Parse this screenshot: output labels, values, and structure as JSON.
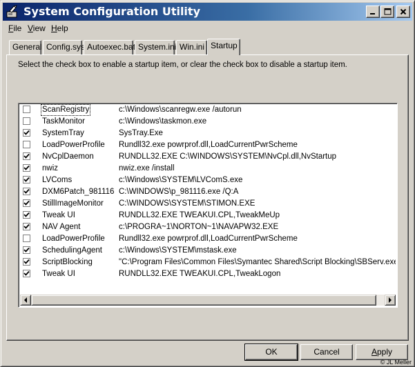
{
  "window": {
    "title": "System Configuration Utility"
  },
  "menu": [
    {
      "prefix": "",
      "accel": "F",
      "rest": "ile"
    },
    {
      "prefix": "",
      "accel": "V",
      "rest": "iew"
    },
    {
      "prefix": "",
      "accel": "H",
      "rest": "elp"
    }
  ],
  "tabs": [
    {
      "label": "General"
    },
    {
      "label": "Config.sys"
    },
    {
      "label": "Autoexec.bat"
    },
    {
      "label": "System.ini"
    },
    {
      "label": "Win.ini"
    },
    {
      "label": "Startup"
    }
  ],
  "active_tab": "Startup",
  "startup": {
    "instructions": "Select the check box to enable a startup item, or clear the check box to disable a startup item.",
    "items": [
      {
        "checked": false,
        "name": "ScanRegistry",
        "command": "c:\\Windows\\scanregw.exe /autorun"
      },
      {
        "checked": false,
        "name": "TaskMonitor",
        "command": "c:\\Windows\\taskmon.exe"
      },
      {
        "checked": true,
        "name": "SystemTray",
        "command": "SysTray.Exe"
      },
      {
        "checked": false,
        "name": "LoadPowerProfile",
        "command": "Rundll32.exe powrprof.dll,LoadCurrentPwrScheme"
      },
      {
        "checked": true,
        "name": "NvCplDaemon",
        "command": "RUNDLL32.EXE C:\\WINDOWS\\SYSTEM\\NvCpl.dll,NvStartup"
      },
      {
        "checked": true,
        "name": "nwiz",
        "command": "nwiz.exe /install"
      },
      {
        "checked": true,
        "name": "LVComs",
        "command": "c:\\Windows\\SYSTEM\\LVComS.exe"
      },
      {
        "checked": true,
        "name": "DXM6Patch_981116",
        "command": "C:\\WINDOWS\\p_981116.exe /Q:A"
      },
      {
        "checked": true,
        "name": "StillImageMonitor",
        "command": "C:\\WINDOWS\\SYSTEM\\STIMON.EXE"
      },
      {
        "checked": true,
        "name": "Tweak UI",
        "command": "RUNDLL32.EXE TWEAKUI.CPL,TweakMeUp"
      },
      {
        "checked": true,
        "name": "NAV Agent",
        "command": "c:\\PROGRA~1\\NORTON~1\\NAVAPW32.EXE"
      },
      {
        "checked": false,
        "name": "LoadPowerProfile",
        "command": "Rundll32.exe powrprof.dll,LoadCurrentPwrScheme"
      },
      {
        "checked": true,
        "name": "SchedulingAgent",
        "command": "c:\\Windows\\SYSTEM\\mstask.exe"
      },
      {
        "checked": true,
        "name": "ScriptBlocking",
        "command": "\"C:\\Program Files\\Common Files\\Symantec Shared\\Script Blocking\\SBServ.exe\" -re"
      },
      {
        "checked": true,
        "name": "Tweak UI",
        "command": "RUNDLL32.EXE TWEAKUI.CPL,TweakLogon"
      }
    ]
  },
  "buttons": {
    "ok": "OK",
    "cancel": "Cancel",
    "apply_accel": "A",
    "apply_rest": "pply"
  },
  "credit": "© JL Meller"
}
